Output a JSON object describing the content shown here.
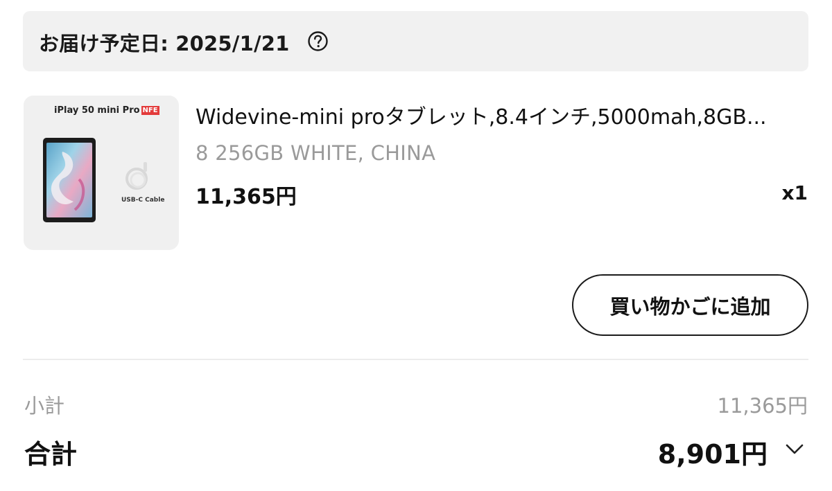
{
  "delivery": {
    "label": "お届け予定日: 2025/1/21",
    "help_icon": "question-circle-icon"
  },
  "product": {
    "image": {
      "title": "iPlay 50 mini Pro",
      "badge": "NFE",
      "cable_label": "USB-C Cable"
    },
    "name": "Widevine-mini proタブレット,8.4インチ,5000mah,8GB...",
    "variant": "8 256GB WHITE, CHINA",
    "price": "11,365円",
    "quantity": "x1"
  },
  "actions": {
    "add_to_cart_label": "買い物かごに追加"
  },
  "summary": {
    "subtotal_label": "小計",
    "subtotal_value": "11,365円",
    "total_label": "合計",
    "total_value": "8,901円",
    "expand_icon": "chevron-down-icon"
  },
  "colors": {
    "delivery_bg": "#f1f1f1",
    "muted_text": "#9a9a9a",
    "badge_red": "#e33b3b"
  }
}
